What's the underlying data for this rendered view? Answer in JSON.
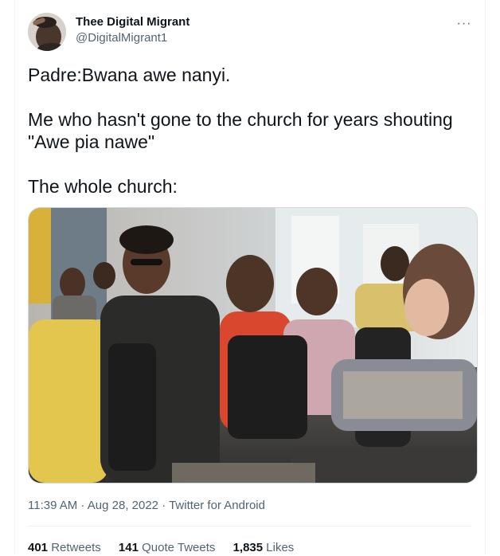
{
  "author": {
    "display_name": "Thee Digital Migrant",
    "handle": "@DigitalMigrant1",
    "avatar_icon": "profile-photo"
  },
  "more_icon": "more-options-icon",
  "tweet": {
    "line1": "Padre:Bwana awe nanyi.",
    "line2": "Me who hasn't gone to the church for years shouting \"Awe pia nawe\"",
    "line3": "The whole church:"
  },
  "meta": {
    "time": "11:39 AM",
    "separator1": " · ",
    "date": "Aug 28, 2022",
    "separator2": " · ",
    "source": "Twitter for Android"
  },
  "stats": {
    "retweets_count": "401",
    "retweets_label": "Retweets",
    "quotes_count": "141",
    "quotes_label": "Quote Tweets",
    "likes_count": "1,835",
    "likes_label": "Likes"
  },
  "colors": {
    "text_primary": "#0f1419",
    "text_secondary": "#536471",
    "border": "#eff3f4"
  }
}
